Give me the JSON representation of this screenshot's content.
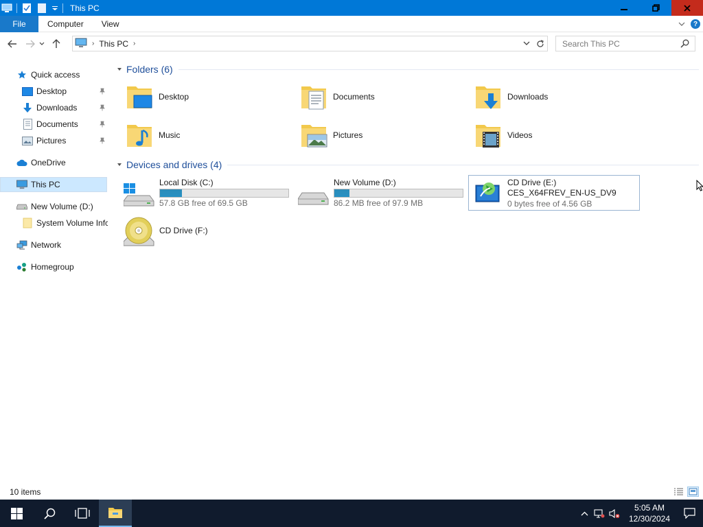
{
  "window": {
    "title": "This PC",
    "accent_color": "#0078d7",
    "close_color": "#c42b1c"
  },
  "ribbon": {
    "file_label": "File",
    "tabs": [
      "Computer",
      "View"
    ]
  },
  "navigation": {
    "breadcrumb": [
      "This PC"
    ],
    "search_placeholder": "Search This PC"
  },
  "sidebar": {
    "items": [
      {
        "label": "Quick access",
        "icon": "star-icon"
      },
      {
        "label": "Desktop",
        "icon": "desktop-icon",
        "pinned": true
      },
      {
        "label": "Downloads",
        "icon": "download-arrow-icon",
        "pinned": true
      },
      {
        "label": "Documents",
        "icon": "documents-icon",
        "pinned": true
      },
      {
        "label": "Pictures",
        "icon": "pictures-icon",
        "pinned": true
      },
      {
        "label": "OneDrive",
        "icon": "cloud-icon"
      },
      {
        "label": "This PC",
        "icon": "computer-icon",
        "selected": true
      },
      {
        "label": "New Volume (D:)",
        "icon": "drive-icon"
      },
      {
        "label": "System Volume Infc",
        "icon": "folder-icon"
      },
      {
        "label": "Network",
        "icon": "network-icon"
      },
      {
        "label": "Homegroup",
        "icon": "homegroup-icon"
      }
    ]
  },
  "content": {
    "folders_header": "Folders (6)",
    "folders": [
      {
        "label": "Desktop",
        "icon": "desktop-folder-icon"
      },
      {
        "label": "Documents",
        "icon": "documents-folder-icon"
      },
      {
        "label": "Downloads",
        "icon": "downloads-folder-icon"
      },
      {
        "label": "Music",
        "icon": "music-folder-icon"
      },
      {
        "label": "Pictures",
        "icon": "pictures-folder-icon"
      },
      {
        "label": "Videos",
        "icon": "videos-folder-icon"
      }
    ],
    "drives_header": "Devices and drives (4)",
    "drives": [
      {
        "label": "Local Disk (C:)",
        "free": "57.8 GB free of 69.5 GB",
        "used_fraction": 0.17,
        "icon": "windows-drive-icon"
      },
      {
        "label": "New Volume (D:)",
        "free": "86.2 MB free of 97.9 MB",
        "used_fraction": 0.12,
        "icon": "hard-drive-icon"
      },
      {
        "label": "CD Drive (E:)",
        "volume_name": "CES_X64FREV_EN-US_DV9",
        "free": "0 bytes free of 4.56 GB",
        "icon": "dvd-setup-icon"
      },
      {
        "label": "CD Drive (F:)",
        "icon": "cd-drive-icon"
      }
    ]
  },
  "status": {
    "item_count": "10 items"
  },
  "taskbar": {
    "time": "5:05 AM",
    "date": "12/30/2024"
  }
}
